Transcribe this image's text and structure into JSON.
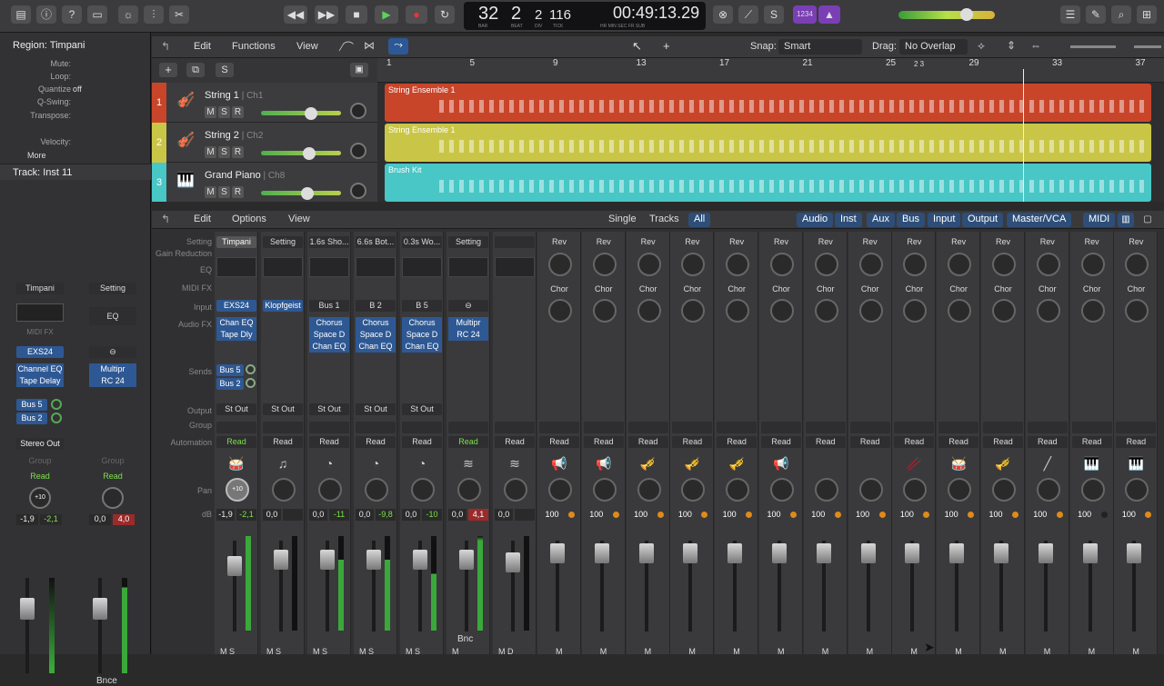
{
  "control_bar": {
    "lcd": {
      "bar": "32",
      "beat": "2",
      "div": "2",
      "tick": "116",
      "time": "00:49:13.29",
      "bar_lbl": "BAR",
      "beat_lbl": "BEAT",
      "div_lbl": "DIV",
      "tick_lbl": "TICK",
      "time_lbls": "HR  MIN  SEC  FR  SUB"
    },
    "count_in": "1234"
  },
  "inspector": {
    "region_title": "Region: Timpani",
    "rows": [
      {
        "k": "Mute:",
        "v": ""
      },
      {
        "k": "Loop:",
        "v": ""
      },
      {
        "k": "Quantize",
        "v": "off"
      },
      {
        "k": "Q-Swing:",
        "v": ""
      },
      {
        "k": "Transpose:",
        "v": ""
      },
      {
        "k": "Velocity:",
        "v": ""
      }
    ],
    "more": "More",
    "track_title": "Track:  Inst 11",
    "strips": [
      {
        "setting": "Timpani",
        "midi_fx": "MIDI FX",
        "input": "EXS24",
        "fx": [
          "Channel EQ",
          "Tape Delay"
        ],
        "sends": [
          "Bus 5",
          "Bus 2"
        ],
        "output": "Stereo Out",
        "group": "Group",
        "auto": "Read",
        "pan": "+10",
        "db": [
          "-1,9",
          "-2,1"
        ],
        "bottom": ""
      },
      {
        "setting": "Setting",
        "eq": "EQ",
        "fx": [
          "Multipr",
          "RC 24"
        ],
        "group": "Group",
        "auto": "Read",
        "db": [
          "0,0",
          "4,0"
        ],
        "bottom": "Bnce"
      }
    ]
  },
  "tracks_header": {
    "menus": [
      "Edit",
      "Functions",
      "View"
    ],
    "snap_lbl": "Snap:",
    "snap": "Smart",
    "drag_lbl": "Drag:",
    "drag": "No Overlap"
  },
  "ruler": [
    "1",
    "5",
    "9",
    "13",
    "17",
    "21",
    "25",
    "29",
    "33",
    "37"
  ],
  "tracks": [
    {
      "num": "1",
      "name": "String 1",
      "ch": "Ch1",
      "color": "#c8452a",
      "region": "String Ensemble 1"
    },
    {
      "num": "2",
      "name": "String 2",
      "ch": "Ch2",
      "color": "#c9c647",
      "region": "String Ensemble 1"
    },
    {
      "num": "3",
      "name": "Grand Piano",
      "ch": "Ch8",
      "color": "#49c6c6",
      "region": "Brush Kit"
    }
  ],
  "mixer_header": {
    "menus": [
      "Edit",
      "Options",
      "View"
    ],
    "views": [
      "Single",
      "Tracks",
      "All"
    ],
    "filters": [
      "Audio",
      "Inst",
      "Aux",
      "Bus",
      "Input",
      "Output",
      "Master/VCA",
      "MIDI"
    ]
  },
  "mixer_labels": [
    "Setting",
    "Gain Reduction",
    "EQ",
    "MIDI FX",
    "Input",
    "Audio FX",
    "Sends",
    "Output",
    "Group",
    "Automation",
    "Pan",
    "dB"
  ],
  "strips": [
    {
      "setting": "Timpani",
      "input": "EXS24",
      "input_blue": true,
      "fx": [
        "Chan EQ",
        "Tape Dly"
      ],
      "sends": [
        "Bus 5",
        "Bus 2"
      ],
      "output": "St Out",
      "auto": "Read",
      "auto_green": true,
      "icon": "🥁",
      "db": [
        "-1,9",
        "-2,1"
      ],
      "pan": "+10",
      "ms": "M  S"
    },
    {
      "setting": "Setting",
      "input": "Klopfgeist",
      "input_blue": true,
      "fx": [],
      "sends": [],
      "output": "St Out",
      "auto": "Read",
      "icon": "♫",
      "db": [
        "0,0",
        ""
      ],
      "ms": "M  S"
    },
    {
      "setting": "1.6s Sho...",
      "input": "Bus 1",
      "fx": [
        "Chorus",
        "Space D",
        "Chan EQ"
      ],
      "sends": [],
      "output": "St Out",
      "auto": "Read",
      "icon": "◔",
      "db": [
        "0,0",
        "-11"
      ],
      "ms": "M  S"
    },
    {
      "setting": "6.6s Bot...",
      "input": "B 2",
      "fx": [
        "Chorus",
        "Space D",
        "Chan EQ"
      ],
      "sends": [],
      "output": "St Out",
      "auto": "Read",
      "icon": "◔",
      "db": [
        "0,0",
        "-9,8"
      ],
      "ms": "M  S"
    },
    {
      "setting": "0.3s Wo...",
      "input": "B 5",
      "fx": [
        "Chorus",
        "Space D",
        "Chan EQ"
      ],
      "sends": [],
      "output": "St Out",
      "auto": "Read",
      "icon": "◔",
      "db": [
        "0,0",
        "-10"
      ],
      "ms": "M  S"
    },
    {
      "setting": "Setting",
      "input": "",
      "fx": [
        "Multipr",
        "RC 24"
      ],
      "sends": [],
      "output": "",
      "auto": "Read",
      "auto_green": true,
      "icon": "≋",
      "db": [
        "0,0",
        "4,1"
      ],
      "ms": "M",
      "bottom": "Bnc"
    },
    {
      "setting": "",
      "input": "",
      "fx": [],
      "sends": [],
      "output": "",
      "auto": "Read",
      "icon": "≋",
      "db": [
        "0,0",
        ""
      ],
      "ms": "M  D"
    }
  ],
  "midi_strips": {
    "top": "Rev",
    "mid": "Chor",
    "auto": "Read",
    "db": "100",
    "ms": "M",
    "icons": [
      "📢",
      "📢",
      "🎺",
      "🎺",
      "🎺",
      "📢",
      "",
      "",
      "🥢",
      "🥁",
      "🎺",
      "╱",
      "🎹",
      "🎹"
    ]
  }
}
